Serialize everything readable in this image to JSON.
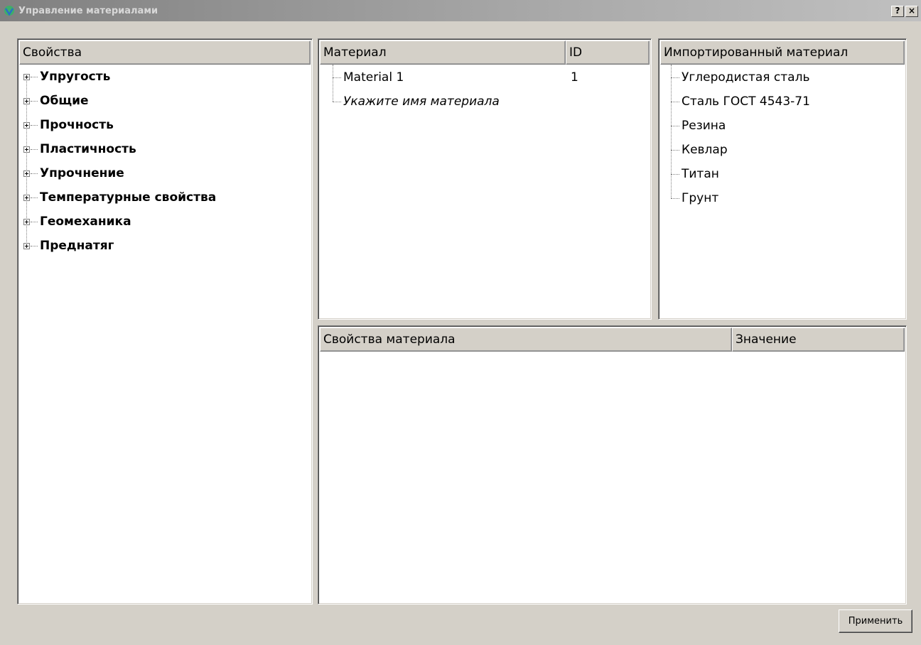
{
  "window": {
    "title": "Управление материалами",
    "help_label": "?",
    "close_label": "×"
  },
  "properties_panel": {
    "header": "Свойства",
    "items": [
      {
        "label": "Упругость"
      },
      {
        "label": "Общие"
      },
      {
        "label": "Прочность"
      },
      {
        "label": "Пластичность"
      },
      {
        "label": "Упрочнение"
      },
      {
        "label": "Температурные свойства"
      },
      {
        "label": "Геомеханика"
      },
      {
        "label": "Преднатяг"
      }
    ]
  },
  "materials_panel": {
    "col_material": "Материал",
    "col_id": "ID",
    "rows": [
      {
        "name": "Material 1",
        "id": "1"
      },
      {
        "name": "Укажите имя материала",
        "id": ""
      }
    ]
  },
  "imported_panel": {
    "header": "Импортированный материал",
    "items": [
      {
        "label": "Углеродистая сталь"
      },
      {
        "label": "Сталь ГОСТ 4543-71"
      },
      {
        "label": "Резина"
      },
      {
        "label": "Кевлар"
      },
      {
        "label": "Титан"
      },
      {
        "label": "Грунт"
      }
    ]
  },
  "material_props_panel": {
    "col_property": "Свойства материала",
    "col_value": "Значение"
  },
  "apply_button": {
    "label": "Применить"
  },
  "colors": {
    "dialog_bg": "#d4d0c8",
    "titlebar": "#808080"
  }
}
